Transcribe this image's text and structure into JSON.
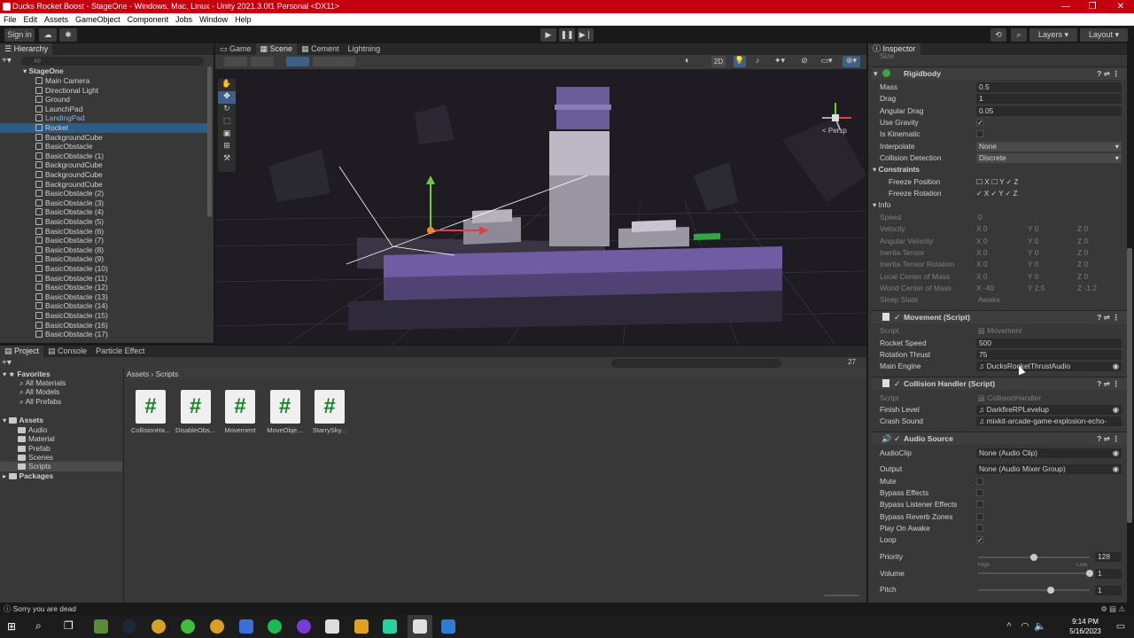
{
  "window": {
    "title": "Ducks Rocket Boost - StageOne - Windows, Mac, Linux - Unity 2021.3.0f1 Personal <DX11>",
    "min": "—",
    "max": "❐",
    "close": "✕"
  },
  "menu": [
    "File",
    "Edit",
    "Assets",
    "GameObject",
    "Component",
    "Jobs",
    "Window",
    "Help"
  ],
  "toolbar": {
    "sign_in": "Sign in",
    "layers": "Layers",
    "layout": "Layout"
  },
  "hierarchy": {
    "tab": "Hierarchy",
    "search_placeholder": "All",
    "scene": "StageOne",
    "items": [
      {
        "label": "Main Camera",
        "style": ""
      },
      {
        "label": "Directional Light",
        "style": ""
      },
      {
        "label": "Ground",
        "style": ""
      },
      {
        "label": "LaunchPad",
        "style": ""
      },
      {
        "label": "LandingPad",
        "style": "blue"
      },
      {
        "label": "Rocket",
        "style": "sel"
      },
      {
        "label": "BackgroundCube",
        "style": ""
      },
      {
        "label": "BasicObstacle",
        "style": ""
      },
      {
        "label": "BasicObstacle (1)",
        "style": ""
      },
      {
        "label": "BackgroundCube",
        "style": ""
      },
      {
        "label": "BackgroundCube",
        "style": ""
      },
      {
        "label": "BackgroundCube",
        "style": ""
      },
      {
        "label": "BasicObstacle (2)",
        "style": ""
      },
      {
        "label": "BasicObstacle (3)",
        "style": ""
      },
      {
        "label": "BasicObstacle (4)",
        "style": ""
      },
      {
        "label": "BasicObstacle (5)",
        "style": ""
      },
      {
        "label": "BasicObstacle (6)",
        "style": ""
      },
      {
        "label": "BasicObstacle (7)",
        "style": ""
      },
      {
        "label": "BasicObstacle (8)",
        "style": ""
      },
      {
        "label": "BasicObstacle (9)",
        "style": ""
      },
      {
        "label": "BasicObstacle (10)",
        "style": ""
      },
      {
        "label": "BasicObstacle (11)",
        "style": ""
      },
      {
        "label": "BasicObstacle (12)",
        "style": ""
      },
      {
        "label": "BasicObstacle (13)",
        "style": ""
      },
      {
        "label": "BasicObstacle (14)",
        "style": ""
      },
      {
        "label": "BasicObstacle (15)",
        "style": ""
      },
      {
        "label": "BasicObstacle (16)",
        "style": ""
      },
      {
        "label": "BasicObstacle (17)",
        "style": ""
      }
    ]
  },
  "scene_tabs": [
    "Game",
    "Scene",
    "Cement",
    "Lightning"
  ],
  "scene_view": {
    "mode_2d": "2D",
    "persp": "< Persp"
  },
  "project": {
    "tabs": [
      "Project",
      "Console",
      "Particle Effect"
    ],
    "count": "27",
    "favorites": {
      "label": "Favorites",
      "items": [
        "All Materials",
        "All Models",
        "All Prefabs"
      ]
    },
    "assets": {
      "label": "Assets",
      "items": [
        "Audio",
        "Material",
        "Prefab",
        "Scenes",
        "Scripts"
      ]
    },
    "packages": "Packages",
    "breadcrumb": [
      "Assets",
      "Scripts"
    ],
    "files": [
      "CollisionHa...",
      "DisableObs...",
      "Movement",
      "MoveObje...",
      "StarrySky..."
    ]
  },
  "inspector": {
    "tab": "Inspector",
    "size_label": "Size",
    "rigidbody": {
      "title": "Rigidbody",
      "mass": {
        "label": "Mass",
        "value": "0.5"
      },
      "drag": {
        "label": "Drag",
        "value": "1"
      },
      "angular_drag": {
        "label": "Angular Drag",
        "value": "0.05"
      },
      "use_gravity": {
        "label": "Use Gravity",
        "value": "✓"
      },
      "is_kinematic": {
        "label": "Is Kinematic"
      },
      "interpolate": {
        "label": "Interpolate",
        "value": "None"
      },
      "collision": {
        "label": "Collision Detection",
        "value": "Discrete"
      },
      "constraints": "Constraints",
      "freeze_pos": "Freeze Position",
      "freeze_rot": "Freeze Rotation",
      "info": "Info",
      "info_rows": [
        {
          "label": "Speed",
          "x": "0",
          "y": "",
          "z": ""
        },
        {
          "label": "Velocity",
          "x": "0",
          "y": "0",
          "z": "0"
        },
        {
          "label": "Angular Velocity",
          "x": "0",
          "y": "0",
          "z": "0"
        },
        {
          "label": "Inertia Tensor",
          "x": "0",
          "y": "0",
          "z": "0"
        },
        {
          "label": "Inertia Tensor Rotation",
          "x": "0",
          "y": "0",
          "z": "0"
        },
        {
          "label": "Local Center of Mass",
          "x": "0",
          "y": "0",
          "z": "0"
        },
        {
          "label": "World Center of Mass",
          "x": "-40",
          "y": "2.5",
          "z": "-1.2"
        }
      ],
      "sleep_state": {
        "label": "Sleep State",
        "value": "Awake"
      }
    },
    "movement": {
      "title": "Movement (Script)",
      "script": {
        "label": "Script",
        "value": "Movement"
      },
      "rocket_speed": {
        "label": "Rocket Speed",
        "value": "500"
      },
      "rotation_thrust": {
        "label": "Rotation Thrust",
        "value": "75"
      },
      "main_engine": {
        "label": "Main Engine",
        "value": "DucksRocketThrustAudio"
      }
    },
    "collision": {
      "title": "Collision Handler (Script)",
      "script": {
        "label": "Script",
        "value": "CollisionHandler"
      },
      "finish": {
        "label": "Finish Level",
        "value": "DarkfireRPLevelup"
      },
      "crash": {
        "label": "Crash Sound",
        "value": "mixkit-arcade-game-explosion-echo-"
      }
    },
    "audio": {
      "title": "Audio Source",
      "clip": {
        "label": "AudioClip",
        "value": "None (Audio Clip)"
      },
      "output": {
        "label": "Output",
        "value": "None (Audio Mixer Group)"
      },
      "mute": "Mute",
      "bypass_effects": "Bypass Effects",
      "bypass_listener": "Bypass Listener Effects",
      "bypass_reverb": "Bypass Reverb Zones",
      "play_on_awake": "Play On Awake",
      "loop": {
        "label": "Loop",
        "value": "✓"
      },
      "priority": {
        "label": "Priority",
        "value": "128",
        "high": "High",
        "low": "Low",
        "level": 0.5
      },
      "volume": {
        "label": "Volume",
        "value": "1",
        "level": 1
      },
      "pitch": {
        "label": "Pitch",
        "value": "1",
        "level": 0.65
      }
    }
  },
  "status": {
    "message": "Sorry you are dead"
  },
  "taskbar": {
    "time": "9:14 PM",
    "date": "5/16/2023"
  },
  "colors": {
    "titlebar": "#c4000e",
    "selection": "#2c5d87",
    "panel": "#383838"
  }
}
